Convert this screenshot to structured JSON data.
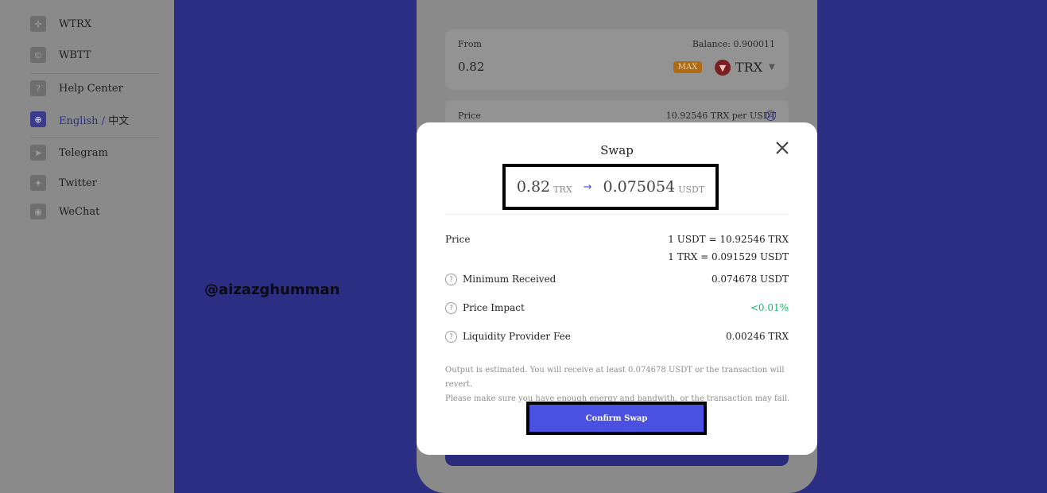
{
  "sidebar": {
    "items": [
      {
        "label": "WTRX",
        "icon": "tree-icon",
        "glyph": "✢"
      },
      {
        "label": "WBTT",
        "icon": "coin-icon",
        "glyph": "©"
      },
      {
        "label": "Help Center",
        "icon": "help-icon",
        "glyph": "?"
      },
      {
        "label_active": "English",
        "label_sep": " / ",
        "label_alt": "中文",
        "icon": "globe-icon",
        "glyph": "⊕"
      },
      {
        "label": "Telegram",
        "icon": "telegram-icon",
        "glyph": "➤"
      },
      {
        "label": "Twitter",
        "icon": "twitter-icon",
        "glyph": "✦"
      },
      {
        "label": "WeChat",
        "icon": "wechat-icon",
        "glyph": "◉"
      }
    ]
  },
  "watermark": "@aizazghumman",
  "background_card": {
    "from_label": "From",
    "balance": "Balance: 0.900011",
    "from_value": "0.82",
    "max_label": "MAX",
    "token_symbol": "TRX",
    "price_label": "Price",
    "price_value": "10.92546 TRX per USDT"
  },
  "modal": {
    "title": "Swap",
    "from_amount": "0.82",
    "from_unit": "TRX",
    "arrow": "→",
    "to_amount": "0.075054",
    "to_unit": "USDT",
    "price_label": "Price",
    "price_line1": "1 USDT = 10.92546 TRX",
    "price_line2": "1 TRX = 0.091529 USDT",
    "min_received_label": "Minimum Received",
    "min_received_value": "0.074678 USDT",
    "price_impact_label": "Price Impact",
    "price_impact_value": "<0.01%",
    "lp_fee_label": "Liquidity Provider Fee",
    "lp_fee_value": "0.00246 TRX",
    "note_line1": "Output is estimated. You will receive at least 0.074678 USDT or the transaction will revert.",
    "note_line2": "Please make sure you have enough energy and bandwith, or the transaction may fail.",
    "confirm_label": "Confirm Swap"
  },
  "colors": {
    "main_bg": "#2b2e82",
    "accent": "#4a50e0",
    "impact_green": "#19b466"
  }
}
